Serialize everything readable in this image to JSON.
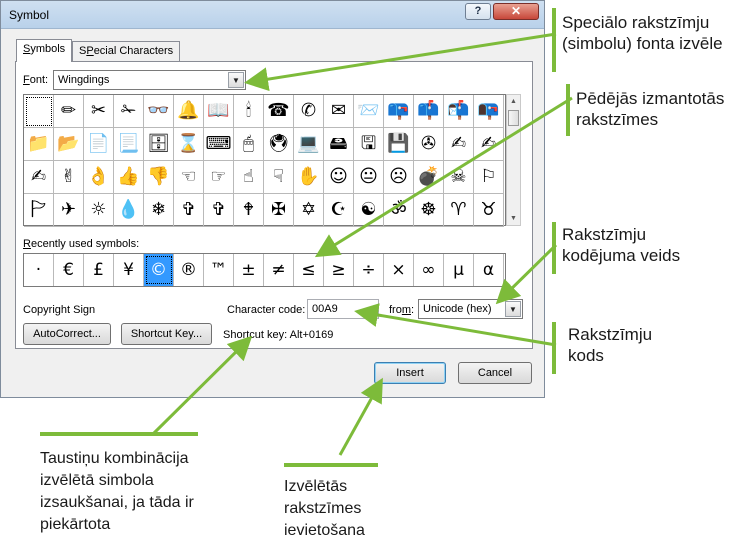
{
  "window": {
    "title": "Symbol",
    "help_label": "?",
    "close_label": "✕"
  },
  "tabs": [
    {
      "label": "Symbols",
      "accel": "S",
      "rest": "ymbols"
    },
    {
      "label": "Special Characters",
      "accel": "P",
      "rest": "ecial Characters",
      "prefix": "S"
    }
  ],
  "font": {
    "label_accel": "F",
    "label_rest": "ont:",
    "value": "Wingdings"
  },
  "symbol_grid": {
    "rows": [
      [
        " ",
        "✏",
        "✂",
        "✁",
        "👓",
        "🔔",
        "📖",
        "🕯",
        "☎",
        "✆",
        "✉",
        "📨",
        "📪",
        "📫",
        "📬",
        "📭"
      ],
      [
        "📁",
        "📂",
        "📄",
        "📃",
        "🗄",
        "⌛",
        "⌨",
        "🖱",
        "🖲",
        "💻",
        "🖴",
        "🖫",
        "💾",
        "✇",
        "✍",
        "✍"
      ],
      [
        "✍",
        "✌",
        "👌",
        "👍",
        "👎",
        "☜",
        "☞",
        "☝",
        "☟",
        "✋",
        "☺",
        "😐",
        "☹",
        "💣",
        "☠",
        "⚐"
      ],
      [
        "🏱",
        "✈",
        "☼",
        "💧",
        "❄",
        "✞",
        "✞",
        "🕈",
        "✠",
        "✡",
        "☪",
        "☯",
        "ॐ",
        "☸",
        "♈",
        "♉"
      ]
    ]
  },
  "recent": {
    "label_accel": "R",
    "label_rest": "ecently used symbols:",
    "symbols": [
      "·",
      "€",
      "£",
      "¥",
      "©",
      "®",
      "™",
      "±",
      "≠",
      "≤",
      "≥",
      "÷",
      "×",
      "∞",
      "µ",
      "α"
    ]
  },
  "char_name": "Copyright Sign",
  "char_code": {
    "label": "Character code:",
    "value": "00A9"
  },
  "from": {
    "label_accel": "m",
    "label_pre": "fro",
    "label_post": ":",
    "value": "Unicode (hex)"
  },
  "buttons": {
    "autocorrect": "AutoCorrect...",
    "shortcut_key": "Shortcut Key...",
    "insert": "Insert",
    "cancel": "Cancel"
  },
  "shortcut_text": "Shortcut key: Alt+0169",
  "annotations": {
    "font_select": [
      "Speciālo rakstzīmju",
      "(simbolu) fonta izvēle"
    ],
    "recent_symbols": [
      "Pēdējās izmantotās",
      "rakstzīmes"
    ],
    "encoding": [
      "Rakstzīmju",
      "kodējuma veids"
    ],
    "code": [
      "Rakstzīmju",
      "kods"
    ],
    "shortcut": [
      "Taustiņu kombinācija",
      "izvēlētā simbola",
      "izsaukšanai, ja tāda ir",
      "piekārtota"
    ],
    "insert": [
      "Izvēlētās",
      "rakstzīmes",
      "ievietošana"
    ]
  },
  "colors": {
    "annotation_green": "#7dbb3a",
    "selection_blue": "#3399ff",
    "title_bar": "#b9d1ea"
  }
}
